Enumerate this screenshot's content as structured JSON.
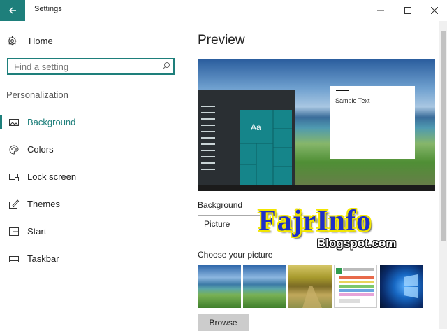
{
  "window": {
    "title": "Settings"
  },
  "sidebar": {
    "home_label": "Home",
    "search": {
      "placeholder": "Find a setting",
      "value": ""
    },
    "section_title": "Personalization",
    "items": [
      {
        "label": "Background",
        "icon": "picture-icon",
        "active": true
      },
      {
        "label": "Colors",
        "icon": "palette-icon",
        "active": false
      },
      {
        "label": "Lock screen",
        "icon": "lock-screen-icon",
        "active": false
      },
      {
        "label": "Themes",
        "icon": "themes-icon",
        "active": false
      },
      {
        "label": "Start",
        "icon": "start-icon",
        "active": false
      },
      {
        "label": "Taskbar",
        "icon": "taskbar-icon",
        "active": false
      }
    ]
  },
  "main": {
    "title": "Preview",
    "preview": {
      "tile_text": "Aa",
      "sample_text": "Sample Text"
    },
    "background_label": "Background",
    "background_value": "Picture",
    "choose_label": "Choose your picture",
    "browse_label": "Browse"
  },
  "watermark": {
    "main": "FajrInfo",
    "sub": "Blogspot.com"
  },
  "colors": {
    "accent": "#1e7f7b",
    "tile": "#15858a"
  }
}
